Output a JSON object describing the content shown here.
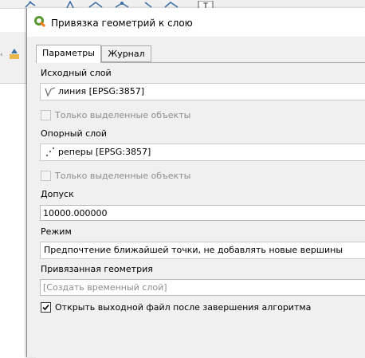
{
  "dialog": {
    "title": "Привязка геометрий к слою",
    "tabs": [
      {
        "label": "Параметры",
        "active": true
      },
      {
        "label": "Журнал",
        "active": false
      }
    ]
  },
  "params": {
    "input_layer": {
      "label": "Исходный слой",
      "value": "линия [EPSG:3857]",
      "icon": "line-layer-icon"
    },
    "input_selected_only": {
      "label": "Только выделенные объекты",
      "checked": false
    },
    "reference_layer": {
      "label": "Опорный слой",
      "value": "реперы [EPSG:3857]",
      "icon": "point-layer-icon"
    },
    "reference_selected_only": {
      "label": "Только выделенные объекты",
      "checked": false
    },
    "tolerance": {
      "label": "Допуск",
      "value": "10000.000000"
    },
    "mode": {
      "label": "Режим",
      "value": "Предпочтение ближайшей точки, не добавлять новые вершины"
    },
    "output": {
      "label": "Привязанная геометрия",
      "placeholder": "[Создать временный слой]"
    },
    "open_output": {
      "label": "Открыть выходной файл после завершения алгоритма",
      "checked": true
    }
  },
  "colors": {
    "qgis_green": "#589632",
    "qgis_yellow": "#ee7913",
    "dialog_bg": "#f0f0f0"
  }
}
